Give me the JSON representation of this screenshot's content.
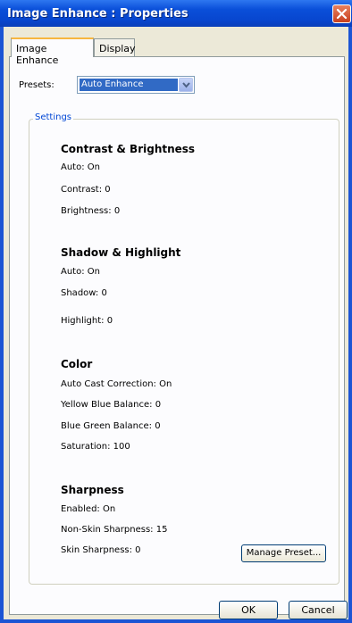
{
  "window": {
    "title": "Image Enhance : Properties"
  },
  "tabs": [
    {
      "label": "Image Enhance",
      "active": true
    },
    {
      "label": "Display",
      "active": false
    }
  ],
  "presets": {
    "label": "Presets:",
    "selected": "Auto Enhance"
  },
  "settings": {
    "legend": "Settings",
    "contrast_brightness": {
      "heading": "Contrast & Brightness",
      "auto": "Auto:  On",
      "contrast": "Contrast: 0",
      "brightness": "Brightness:  0"
    },
    "shadow_highlight": {
      "heading": "Shadow & Highlight",
      "auto": "Auto:  On",
      "shadow": "Shadow: 0",
      "highlight": "Highlight:  0"
    },
    "color": {
      "heading": "Color",
      "auto_cast": "Auto Cast Correction:  On",
      "yellow_blue": "Yellow Blue Balance:  0",
      "blue_green": "Blue Green Balance:  0",
      "saturation": "Saturation:  100"
    },
    "sharpness": {
      "heading": "Sharpness",
      "enabled": "Enabled:  On",
      "non_skin": "Non-Skin Sharpness:  15",
      "skin": "Skin Sharpness:  0"
    }
  },
  "buttons": {
    "manage_preset": "Manage Preset...",
    "ok": "OK",
    "cancel": "Cancel"
  }
}
